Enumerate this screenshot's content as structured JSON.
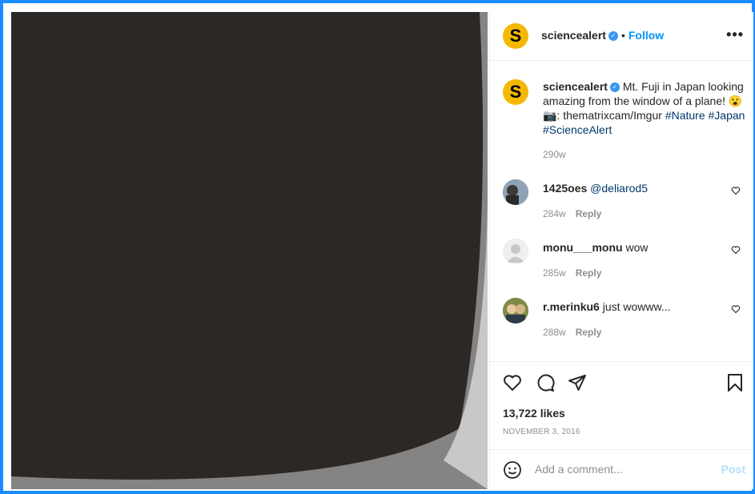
{
  "post": {
    "author": "sciencealert",
    "logo_letter": "S",
    "follow_label": "Follow",
    "more_label": "•••",
    "caption_text": "Mt. Fuji in Japan looking amazing from the window of a plane! 😮",
    "credit_text": "📷: thematrixcam/Imgur",
    "hashtags": [
      "#Nature",
      "#Japan",
      "#ScienceAlert"
    ],
    "caption_time": "290w"
  },
  "comments": [
    {
      "user": "1425oes",
      "text": "@deliarod5",
      "time": "284w",
      "reply": "Reply"
    },
    {
      "user": "monu___monu",
      "text": "wow",
      "time": "285w",
      "reply": "Reply"
    },
    {
      "user": "r.merinku6",
      "text": "just wowww...",
      "time": "288w",
      "reply": "Reply"
    }
  ],
  "stats": {
    "likes": "13,722 likes",
    "date": "NOVEMBER 3, 2016"
  },
  "composer": {
    "placeholder": "Add a comment...",
    "post_label": "Post"
  },
  "colors": {
    "accent_border": "#1a8cff",
    "link_blue": "#0095f6",
    "hashtag": "#00376b",
    "logo_yellow": "#f5b800"
  }
}
